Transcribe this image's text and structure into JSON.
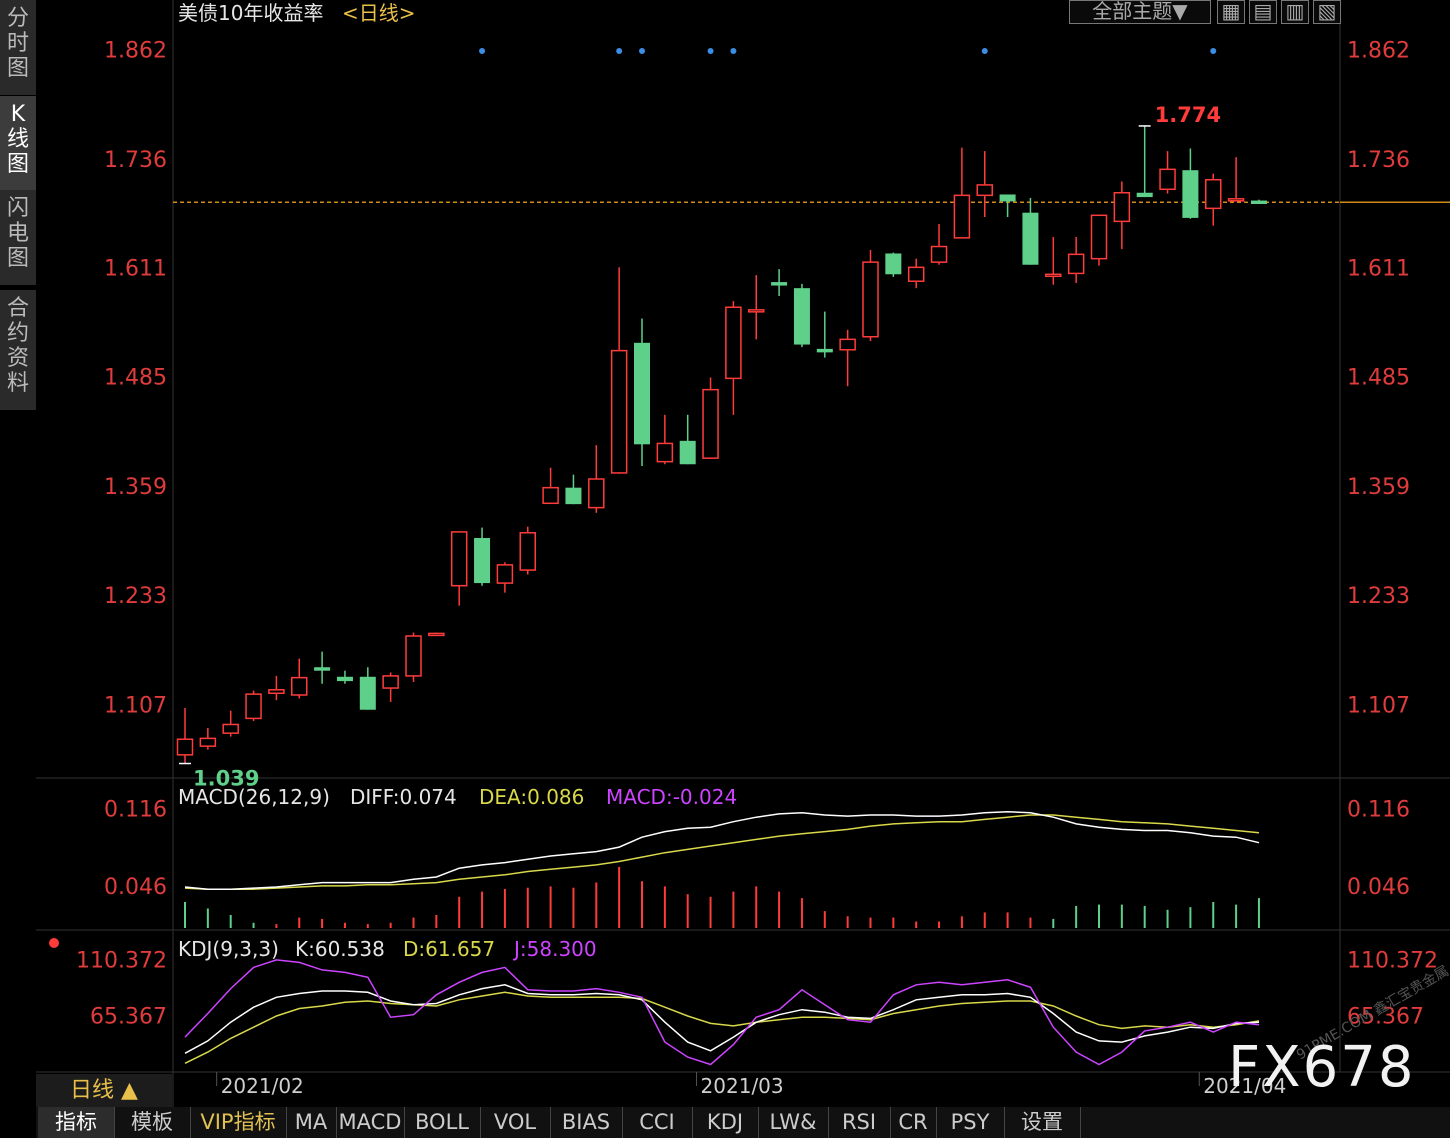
{
  "header": {
    "title": "美债10年收益率",
    "period_tag": "<日线>"
  },
  "side_tabs": [
    {
      "chars": [
        "分",
        "时",
        "图"
      ],
      "active": false
    },
    {
      "chars": [
        "K",
        "线",
        "图"
      ],
      "active": true
    },
    {
      "chars": [
        "闪",
        "电",
        "图"
      ],
      "active": false
    },
    {
      "chars": [
        "合",
        "约",
        "资",
        "料"
      ],
      "active": false
    }
  ],
  "toolbar": {
    "theme_label": "全部主题▼",
    "icons": [
      "grid-icon",
      "layout-1-icon",
      "layout-2-icon",
      "layout-3-icon"
    ]
  },
  "price_axis": {
    "ticks": [
      "1.862",
      "1.736",
      "1.611",
      "1.485",
      "1.359",
      "1.233",
      "1.107"
    ],
    "current_line": 1.686
  },
  "annotations": {
    "high_label": "1.774",
    "low_label": "1.039"
  },
  "chart_data": [
    {
      "type": "candlestick",
      "name": "main",
      "y_range": [
        1.02,
        1.88
      ],
      "marker_days": [
        13,
        19,
        20,
        23,
        24,
        35,
        45
      ],
      "candles": [
        {
          "o": 1.049,
          "c": 1.067,
          "h": 1.103,
          "l": 1.039
        },
        {
          "o": 1.059,
          "c": 1.068,
          "h": 1.08,
          "l": 1.055
        },
        {
          "o": 1.074,
          "c": 1.084,
          "h": 1.1,
          "l": 1.07
        },
        {
          "o": 1.091,
          "c": 1.119,
          "h": 1.123,
          "l": 1.088
        },
        {
          "o": 1.12,
          "c": 1.124,
          "h": 1.14,
          "l": 1.112
        },
        {
          "o": 1.118,
          "c": 1.138,
          "h": 1.16,
          "l": 1.114
        },
        {
          "o": 1.15,
          "c": 1.146,
          "h": 1.168,
          "l": 1.131
        },
        {
          "o": 1.139,
          "c": 1.134,
          "h": 1.146,
          "l": 1.131
        },
        {
          "o": 1.139,
          "c": 1.101,
          "h": 1.15,
          "l": 1.101
        },
        {
          "o": 1.126,
          "c": 1.14,
          "h": 1.144,
          "l": 1.11
        },
        {
          "o": 1.14,
          "c": 1.186,
          "h": 1.19,
          "l": 1.133
        },
        {
          "o": 1.189,
          "c": 1.189,
          "h": 1.19,
          "l": 1.188
        },
        {
          "o": 1.244,
          "c": 1.306,
          "h": 1.306,
          "l": 1.221
        },
        {
          "o": 1.299,
          "c": 1.247,
          "h": 1.311,
          "l": 1.244
        },
        {
          "o": 1.247,
          "c": 1.268,
          "h": 1.271,
          "l": 1.236
        },
        {
          "o": 1.262,
          "c": 1.305,
          "h": 1.312,
          "l": 1.257
        },
        {
          "o": 1.339,
          "c": 1.357,
          "h": 1.38,
          "l": 1.339
        },
        {
          "o": 1.357,
          "c": 1.338,
          "h": 1.372,
          "l": 1.338
        },
        {
          "o": 1.334,
          "c": 1.367,
          "h": 1.406,
          "l": 1.328
        },
        {
          "o": 1.374,
          "c": 1.515,
          "h": 1.611,
          "l": 1.373
        },
        {
          "o": 1.524,
          "c": 1.407,
          "h": 1.552,
          "l": 1.382
        },
        {
          "o": 1.387,
          "c": 1.408,
          "h": 1.441,
          "l": 1.384
        },
        {
          "o": 1.411,
          "c": 1.384,
          "h": 1.441,
          "l": 1.384
        },
        {
          "o": 1.391,
          "c": 1.47,
          "h": 1.484,
          "l": 1.391
        },
        {
          "o": 1.483,
          "c": 1.565,
          "h": 1.572,
          "l": 1.441
        },
        {
          "o": 1.562,
          "c": 1.562,
          "h": 1.602,
          "l": 1.528
        },
        {
          "o": 1.594,
          "c": 1.59,
          "h": 1.609,
          "l": 1.578
        },
        {
          "o": 1.587,
          "c": 1.522,
          "h": 1.592,
          "l": 1.519
        },
        {
          "o": 1.517,
          "c": 1.513,
          "h": 1.56,
          "l": 1.507
        },
        {
          "o": 1.516,
          "c": 1.528,
          "h": 1.539,
          "l": 1.474
        },
        {
          "o": 1.531,
          "c": 1.617,
          "h": 1.631,
          "l": 1.526
        },
        {
          "o": 1.627,
          "c": 1.603,
          "h": 1.628,
          "l": 1.6
        },
        {
          "o": 1.595,
          "c": 1.611,
          "h": 1.621,
          "l": 1.587
        },
        {
          "o": 1.617,
          "c": 1.635,
          "h": 1.661,
          "l": 1.614
        },
        {
          "o": 1.645,
          "c": 1.694,
          "h": 1.749,
          "l": 1.645
        },
        {
          "o": 1.694,
          "c": 1.706,
          "h": 1.745,
          "l": 1.669
        },
        {
          "o": 1.695,
          "c": 1.687,
          "h": 1.695,
          "l": 1.669
        },
        {
          "o": 1.674,
          "c": 1.614,
          "h": 1.691,
          "l": 1.614
        },
        {
          "o": 1.603,
          "c": 1.603,
          "h": 1.646,
          "l": 1.591
        },
        {
          "o": 1.604,
          "c": 1.626,
          "h": 1.646,
          "l": 1.593
        },
        {
          "o": 1.621,
          "c": 1.671,
          "h": 1.671,
          "l": 1.613
        },
        {
          "o": 1.664,
          "c": 1.697,
          "h": 1.71,
          "l": 1.632
        },
        {
          "o": 1.697,
          "c": 1.692,
          "h": 1.774,
          "l": 1.692
        },
        {
          "o": 1.701,
          "c": 1.724,
          "h": 1.745,
          "l": 1.696
        },
        {
          "o": 1.723,
          "c": 1.668,
          "h": 1.748,
          "l": 1.667
        },
        {
          "o": 1.679,
          "c": 1.712,
          "h": 1.719,
          "l": 1.659
        },
        {
          "o": 1.688,
          "c": 1.69,
          "h": 1.738,
          "l": 1.688
        },
        {
          "o": 1.688,
          "c": 1.684,
          "h": 1.689,
          "l": 1.684
        }
      ]
    },
    {
      "type": "macd",
      "name": "MACD(26,12,9)",
      "legend": {
        "name": "MACD(26,12,9)",
        "diff": "DIFF:0.074",
        "dea": "DEA:0.086",
        "macd": "MACD:-0.024"
      },
      "y_ticks": [
        "0.116",
        "0.046"
      ],
      "y_range": [
        0.008,
        0.138
      ],
      "diff": [
        0.045,
        0.043,
        0.043,
        0.044,
        0.045,
        0.047,
        0.049,
        0.049,
        0.049,
        0.049,
        0.052,
        0.054,
        0.062,
        0.065,
        0.067,
        0.07,
        0.073,
        0.075,
        0.077,
        0.081,
        0.09,
        0.095,
        0.098,
        0.099,
        0.104,
        0.108,
        0.111,
        0.112,
        0.11,
        0.109,
        0.11,
        0.11,
        0.109,
        0.109,
        0.11,
        0.112,
        0.113,
        0.112,
        0.108,
        0.102,
        0.099,
        0.097,
        0.096,
        0.096,
        0.094,
        0.091,
        0.09,
        0.085
      ],
      "dea": [
        0.044,
        0.043,
        0.043,
        0.043,
        0.044,
        0.045,
        0.046,
        0.046,
        0.047,
        0.047,
        0.048,
        0.049,
        0.052,
        0.054,
        0.056,
        0.059,
        0.061,
        0.063,
        0.065,
        0.068,
        0.072,
        0.076,
        0.079,
        0.082,
        0.085,
        0.088,
        0.091,
        0.093,
        0.095,
        0.097,
        0.1,
        0.102,
        0.103,
        0.104,
        0.104,
        0.106,
        0.108,
        0.11,
        0.11,
        0.108,
        0.106,
        0.104,
        0.103,
        0.102,
        0.1,
        0.098,
        0.096,
        0.094
      ],
      "macd": [
        -0.02,
        -0.015,
        -0.01,
        -0.004,
        0.003,
        0.008,
        0.007,
        0.004,
        0.003,
        0.004,
        0.008,
        0.01,
        0.024,
        0.028,
        0.03,
        0.031,
        0.032,
        0.031,
        0.035,
        0.047,
        0.036,
        0.032,
        0.026,
        0.024,
        0.028,
        0.032,
        0.028,
        0.023,
        0.013,
        0.009,
        0.008,
        0.008,
        0.005,
        0.005,
        0.009,
        0.012,
        0.012,
        0.008,
        -0.007,
        -0.017,
        -0.018,
        -0.018,
        -0.017,
        -0.014,
        -0.016,
        -0.02,
        -0.018,
        -0.023
      ]
    },
    {
      "type": "kdj",
      "name": "KDJ(9,3,3)",
      "legend": {
        "name": "KDJ(9,3,3)",
        "k": "K:60.538",
        "d": "D:61.657",
        "j": "J:58.300"
      },
      "y_ticks": [
        "110.372",
        "65.367"
      ],
      "y_range": [
        20,
        130
      ],
      "k": [
        35,
        45,
        60,
        72,
        80,
        83,
        85,
        85,
        84,
        77,
        74,
        75,
        82,
        87,
        90,
        83,
        82,
        82,
        83,
        82,
        78,
        60,
        44,
        37,
        48,
        60,
        66,
        70,
        68,
        64,
        63,
        70,
        78,
        80,
        82,
        82,
        83,
        80,
        67,
        52,
        45,
        44,
        49,
        52,
        56,
        55,
        59,
        60
      ],
      "d": [
        27,
        36,
        47,
        56,
        65,
        71,
        73,
        76,
        77,
        75,
        74,
        73,
        78,
        81,
        84,
        81,
        80,
        80,
        80,
        80,
        79,
        72,
        65,
        59,
        57,
        60,
        62,
        64,
        64,
        63,
        62,
        67,
        70,
        73,
        75,
        76,
        77,
        77,
        73,
        65,
        58,
        55,
        57,
        56,
        58,
        56,
        58,
        61
      ],
      "j": [
        48,
        67,
        87,
        104,
        110,
        108,
        102,
        100,
        96,
        64,
        66,
        82,
        92,
        100,
        104,
        86,
        85,
        85,
        87,
        84,
        80,
        44,
        32,
        26,
        42,
        64,
        70,
        86,
        74,
        62,
        60,
        82,
        90,
        92,
        90,
        92,
        94,
        88,
        56,
        36,
        26,
        36,
        53,
        56,
        60,
        52,
        60,
        58
      ]
    }
  ],
  "time_axis": {
    "labels": [
      {
        "day": 2,
        "text": "2021/02"
      },
      {
        "day": 23,
        "text": "2021/03"
      },
      {
        "day": 45,
        "text": "2021/04"
      }
    ]
  },
  "period_button": {
    "label": "日线 ▲"
  },
  "bottom_tabs": [
    {
      "label": "指标",
      "active": true
    },
    {
      "label": "模板",
      "active": false
    },
    {
      "label": "VIP指标",
      "active": false,
      "vip": true
    },
    {
      "label": "MA"
    },
    {
      "label": "MACD"
    },
    {
      "label": "BOLL"
    },
    {
      "label": "VOL"
    },
    {
      "label": "BIAS"
    },
    {
      "label": "CCI"
    },
    {
      "label": "KDJ"
    },
    {
      "label": "LW&"
    },
    {
      "label": "RSI"
    },
    {
      "label": "CR"
    },
    {
      "label": "PSY"
    },
    {
      "label": "设置"
    }
  ],
  "watermark": {
    "text": "FX678",
    "corner": "91PME.COM 鑫汇宝贵金属"
  },
  "colors": {
    "up": "#ff3b3b",
    "down": "#5fd08a",
    "axis_text": "#e03c3c",
    "diff": "#ffffff",
    "dea": "#d8d84a",
    "macd": "#cc44ff",
    "current": "#d08a1a"
  }
}
